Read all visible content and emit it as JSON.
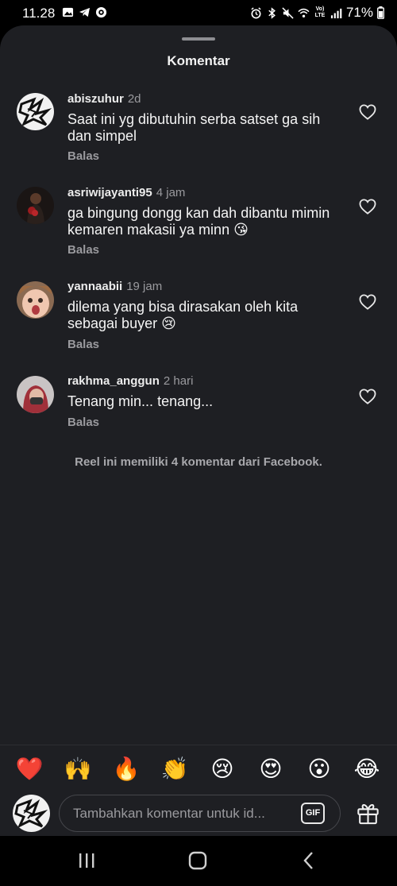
{
  "status_bar": {
    "time": "11.28",
    "battery": "71%",
    "lte_label": "Vo) LTE"
  },
  "sheet": {
    "title": "Komentar"
  },
  "comments": [
    {
      "username": "abiszuhur",
      "time": "2d",
      "text": "Saat ini yg dibutuhin serba satset ga sih dan simpel",
      "reply": "Balas"
    },
    {
      "username": "asriwijayanti95",
      "time": "4 jam",
      "text": "ga bingung dongg kan dah dibantu mimin kemaren makasii ya minn 😘",
      "reply": "Balas"
    },
    {
      "username": "yannaabii",
      "time": "19 jam",
      "text": "dilema yang bisa dirasakan oleh kita sebagai buyer 😢",
      "reply": "Balas"
    },
    {
      "username": "rakhma_anggun",
      "time": "2 hari",
      "text": "Tenang min... tenang...",
      "reply": "Balas"
    }
  ],
  "footer_note": "Reel ini memiliki 4 komentar dari Facebook.",
  "reactions": [
    "❤️",
    "🙌",
    "🔥",
    "👏",
    "😢",
    "😍",
    "😮",
    "😂"
  ],
  "composer": {
    "placeholder": "Tambahkan komentar untuk id...",
    "gif_label": "GIF"
  },
  "colors": {
    "sheet_bg": "#1e1f23",
    "text_primary": "#f4f4f4",
    "text_secondary": "#9a9a9e"
  }
}
